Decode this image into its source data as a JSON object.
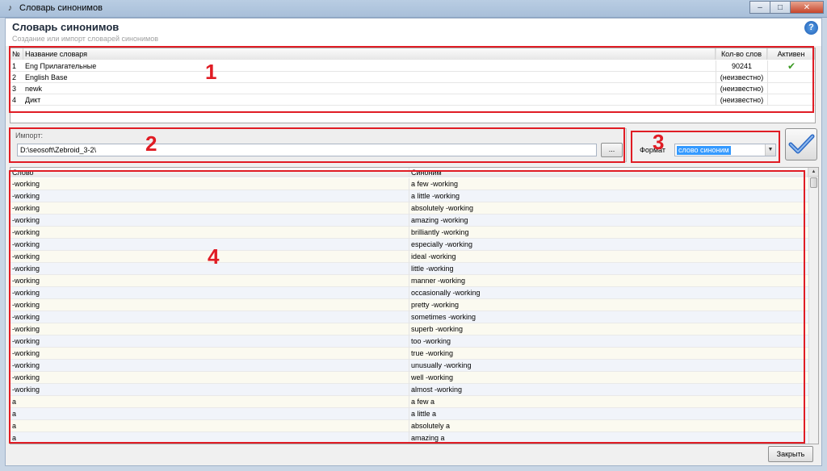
{
  "window": {
    "title": "Словарь синонимов",
    "min": "–",
    "max": "□",
    "close": "✕"
  },
  "header": {
    "title": "Словарь синонимов",
    "subtitle": "Создание или импорт словарей синонимов",
    "help": "?"
  },
  "dictionaries": {
    "columns": [
      "№",
      "Название словаря",
      "Кол-во слов",
      "Активен"
    ],
    "rows": [
      {
        "num": "1",
        "name": "Eng Прилагательные",
        "count": "90241",
        "active": true
      },
      {
        "num": "2",
        "name": "English Base",
        "count": "(неизвестно)",
        "active": false
      },
      {
        "num": "3",
        "name": "newk",
        "count": "(неизвестно)",
        "active": false
      },
      {
        "num": "4",
        "name": "Дикт",
        "count": "(неизвестно)",
        "active": false
      }
    ]
  },
  "import": {
    "legend": "Импорт:",
    "path": "D:\\seosoft\\Zebroid_3-2\\",
    "browse": "..."
  },
  "format": {
    "label": "Формат",
    "selected": "слово синоним"
  },
  "synonyms": {
    "columns": [
      "Слово",
      "Синоним"
    ],
    "rows": [
      [
        "-working",
        "a few -working"
      ],
      [
        "-working",
        "a little -working"
      ],
      [
        "-working",
        "absolutely -working"
      ],
      [
        "-working",
        "amazing -working"
      ],
      [
        "-working",
        "brilliantly -working"
      ],
      [
        "-working",
        "especially -working"
      ],
      [
        "-working",
        "ideal -working"
      ],
      [
        "-working",
        "little -working"
      ],
      [
        "-working",
        "manner -working"
      ],
      [
        "-working",
        "occasionally -working"
      ],
      [
        "-working",
        "pretty -working"
      ],
      [
        "-working",
        "sometimes -working"
      ],
      [
        "-working",
        "superb -working"
      ],
      [
        "-working",
        "too -working"
      ],
      [
        "-working",
        "true -working"
      ],
      [
        "-working",
        "unusually -working"
      ],
      [
        "-working",
        "well -working"
      ],
      [
        "-working",
        "almost -working"
      ],
      [
        "a",
        "a few a"
      ],
      [
        "a",
        "a little a"
      ],
      [
        "a",
        "absolutely a"
      ],
      [
        "a",
        "amazing a"
      ]
    ]
  },
  "footer": {
    "close": "Закрыть"
  },
  "annotations": [
    "1",
    "2",
    "3",
    "4"
  ],
  "colors": {
    "annotation": "#e01c24",
    "selection": "#3399ff",
    "check": "#3a9a23"
  }
}
